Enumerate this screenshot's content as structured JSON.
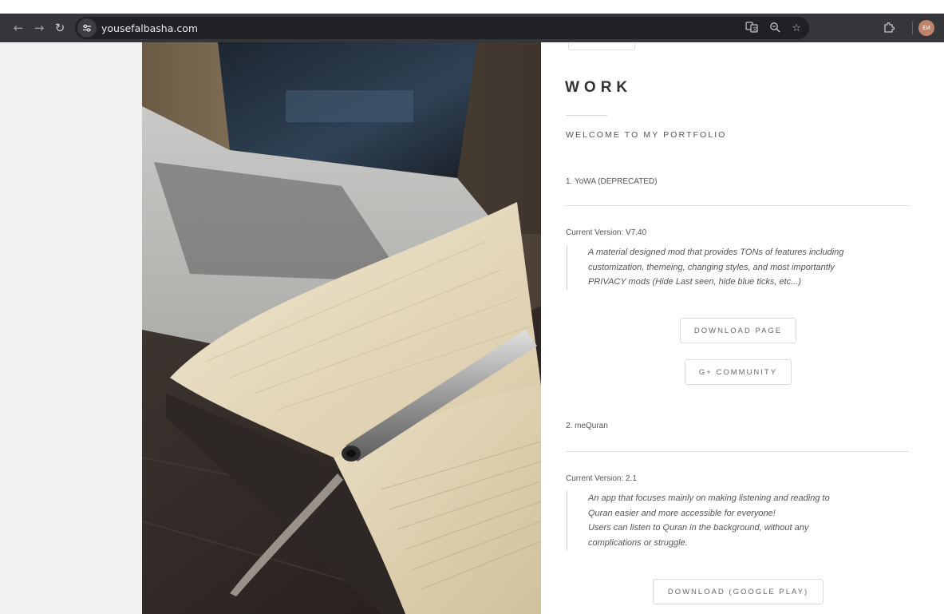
{
  "browser": {
    "url": "yousefalbasha.com",
    "icons": {
      "back": "arrow-left-icon",
      "forward": "arrow-right-icon",
      "reload": "reload-icon",
      "site_info": "tune-icon",
      "translate": "translate-icon",
      "zoom": "zoom-icon",
      "bookmark": "star-icon",
      "extensions": "puzzle-icon"
    },
    "avatar_text": "ЕИ"
  },
  "page": {
    "title": "WORK",
    "subtitle": "WELCOME TO MY PORTFOLIO",
    "projects": [
      {
        "name": "1. YoWA (DEPRECATED)",
        "version": "Current Version: V7.40",
        "description": [
          "A material designed mod that provides TONs of features including",
          "customization, themeing, changing styles, and most importantly",
          "PRIVACY mods (Hide Last seen, hide blue ticks, etc...)"
        ],
        "buttons": [
          "DOWNLOAD PAGE",
          "G+ COMMUNITY"
        ]
      },
      {
        "name": "2. meQuran",
        "version": "Current Version: 2.1",
        "description": [
          "An app that focuses mainly on making listening and reading to",
          "Quran easier and more accessible for everyone!",
          "Users can listen to Quran in the background, without any",
          "complications or struggle."
        ],
        "buttons": [
          "DOWNLOAD (GOOGLE PLAY)"
        ]
      }
    ]
  },
  "colors": {
    "chrome_toolbar": "#35363a",
    "omnibox": "#202124",
    "page_side": "#f1f1f1",
    "text": "#555555",
    "heading": "#333333"
  }
}
